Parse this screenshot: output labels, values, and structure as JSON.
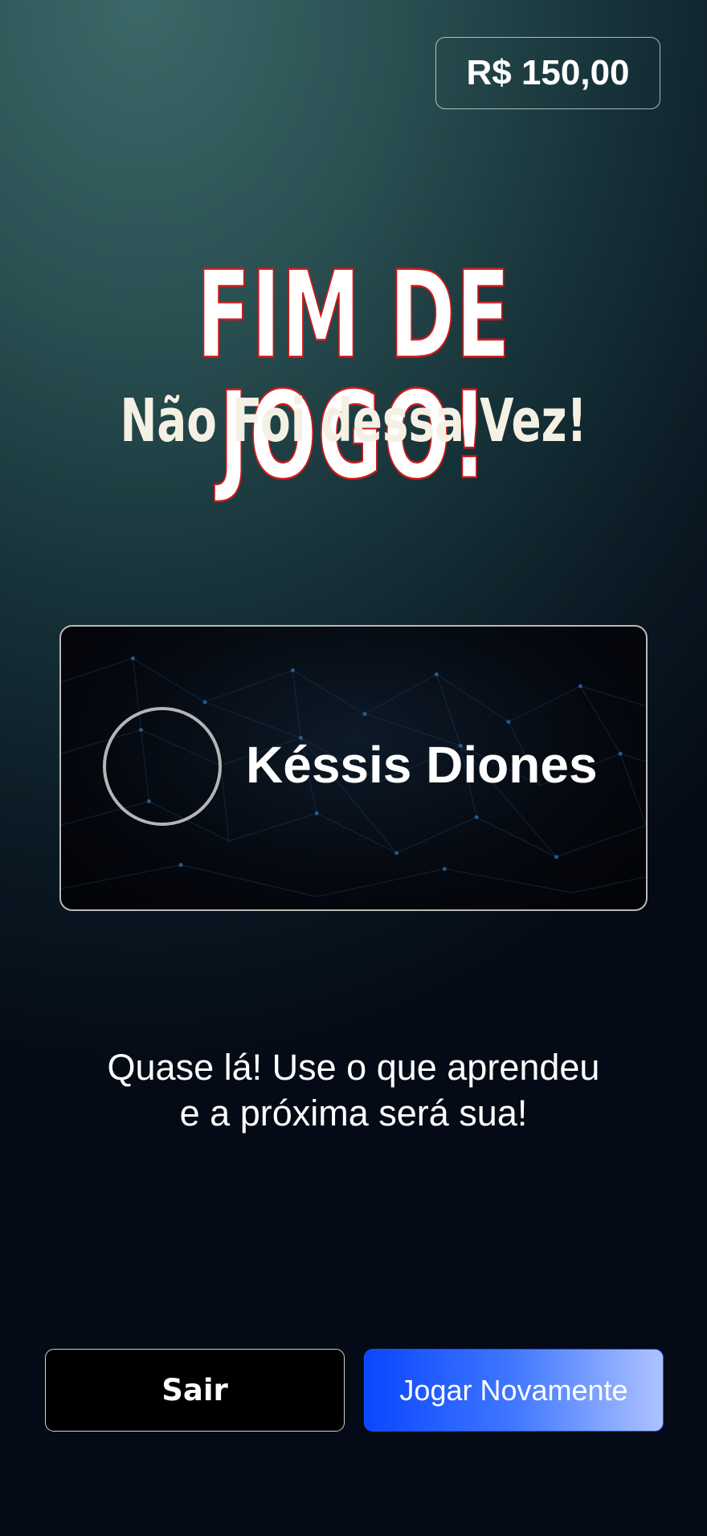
{
  "header": {
    "balance": "R$ 150,00"
  },
  "result": {
    "title": "FIM DE JOGO!",
    "subtitle": "Não Foi dessa Vez!"
  },
  "player": {
    "name": "Késsis Diones"
  },
  "message": {
    "line1": "Quase lá! Use o que aprendeu",
    "line2": "e a próxima será sua!"
  },
  "actions": {
    "exit_label": "Sair",
    "play_again_label": "Jogar Novamente"
  },
  "colors": {
    "title_stroke": "#d11a1a",
    "play_button_start": "#0a46ff",
    "play_button_end": "#aec3ff"
  }
}
